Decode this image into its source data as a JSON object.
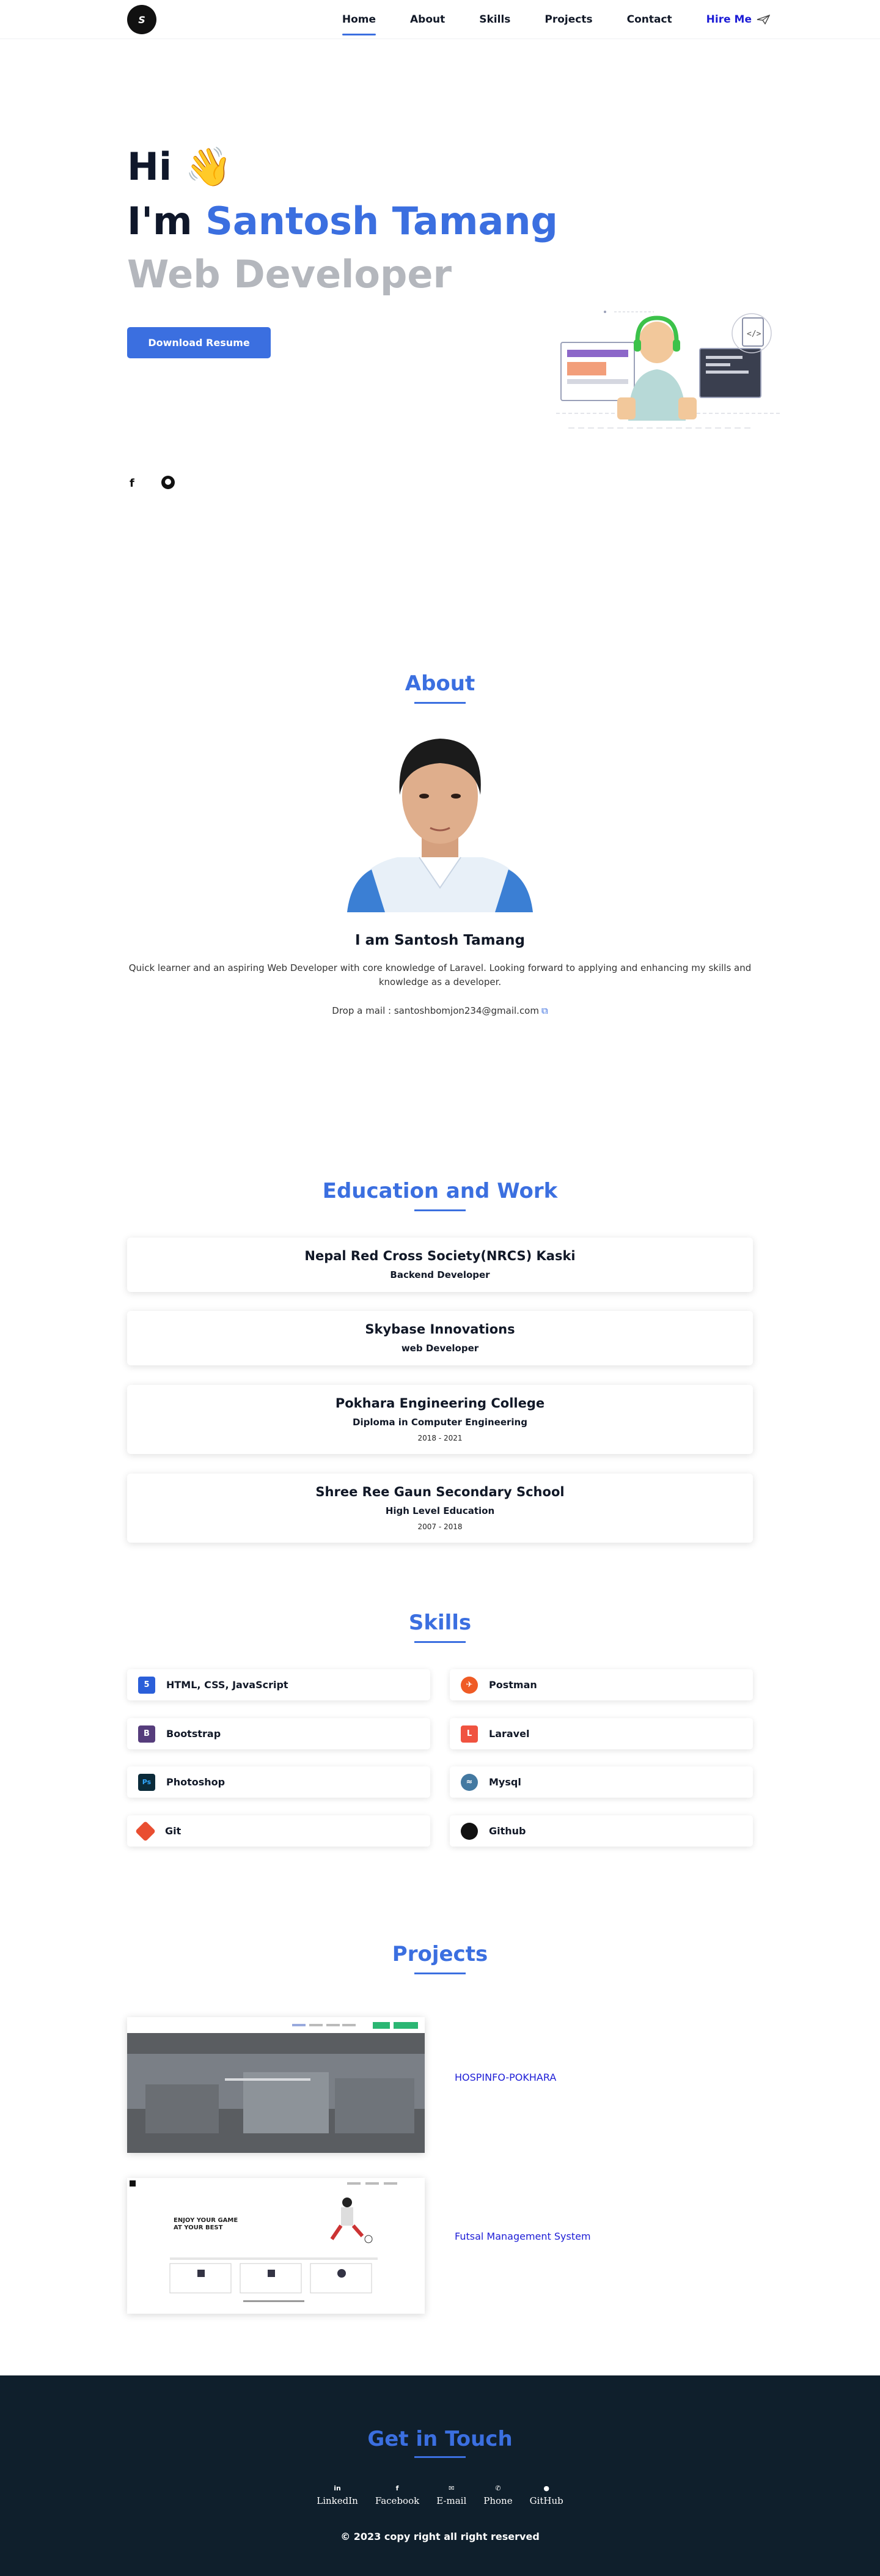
{
  "nav": {
    "logo_text": "S",
    "links": [
      {
        "label": "Home",
        "active": true
      },
      {
        "label": "About"
      },
      {
        "label": "Skills"
      },
      {
        "label": "Projects"
      },
      {
        "label": "Contact"
      }
    ],
    "hire_label": "Hire Me"
  },
  "hero": {
    "greeting": "Hi 👋",
    "im_prefix": "I'm ",
    "name": "Santosh Tamang",
    "role": "Web Developer",
    "resume_button": "Download Resume",
    "social_fb": "f"
  },
  "about": {
    "title": "About",
    "heading": "I am Santosh Tamang",
    "description": "Quick learner and an aspiring Web Developer with core knowledge of Laravel. Looking forward to applying and enhancing my skills and knowledge as a developer.",
    "mail": "Drop a mail : santoshbomjon234@gmail.com"
  },
  "education": {
    "title": "Education and Work",
    "items": [
      {
        "title": "Nepal Red Cross Society(NRCS) Kaski",
        "subtitle": "Backend Developer",
        "years": ""
      },
      {
        "title": "Skybase Innovations",
        "subtitle": "web Developer",
        "years": ""
      },
      {
        "title": "Pokhara Engineering College",
        "subtitle": "Diploma in Computer Engineering",
        "years": "2018 - 2021"
      },
      {
        "title": "Shree Ree Gaun Secondary School",
        "subtitle": "High Level Education",
        "years": "2007 - 2018"
      }
    ]
  },
  "skills": {
    "title": "Skills",
    "items": [
      {
        "label": "HTML, CSS, JavaScript",
        "icon": "html5-icon",
        "color": "#2b5fd9",
        "glyph": "5"
      },
      {
        "label": "Postman",
        "icon": "postman-icon",
        "color": "#ef5b25",
        "glyph": "✈"
      },
      {
        "label": "Bootstrap",
        "icon": "bootstrap-icon",
        "color": "#563d7c",
        "glyph": "B"
      },
      {
        "label": "Laravel",
        "icon": "laravel-icon",
        "color": "#f05340",
        "glyph": "L"
      },
      {
        "label": "Photoshop",
        "icon": "photoshop-icon",
        "color": "#0b2b3a",
        "glyph": "Ps"
      },
      {
        "label": "Mysql",
        "icon": "mysql-icon",
        "color": "#4479a1",
        "glyph": "≈"
      },
      {
        "label": "Git",
        "icon": "git-icon",
        "color": "#e94e31",
        "glyph": "◆"
      },
      {
        "label": "Github",
        "icon": "github-icon",
        "color": "#111111",
        "glyph": "●"
      }
    ]
  },
  "projects": {
    "title": "Projects",
    "items": [
      {
        "label": "HOSPINFO-POKHARA"
      },
      {
        "label": "Futsal Management System"
      }
    ],
    "futsal_headline_1": "ENJOY YOUR GAME",
    "futsal_headline_2": "AT YOUR BEST"
  },
  "footer": {
    "title": "Get in Touch",
    "links": [
      {
        "label": "LinkedIn",
        "icon": "in"
      },
      {
        "label": "Facebook",
        "icon": "f"
      },
      {
        "label": "E-mail",
        "icon": "✉"
      },
      {
        "label": "Phone",
        "icon": "✆"
      },
      {
        "label": "GitHub",
        "icon": "●"
      }
    ],
    "copyright": "© 2023 copy right all right reserved"
  }
}
